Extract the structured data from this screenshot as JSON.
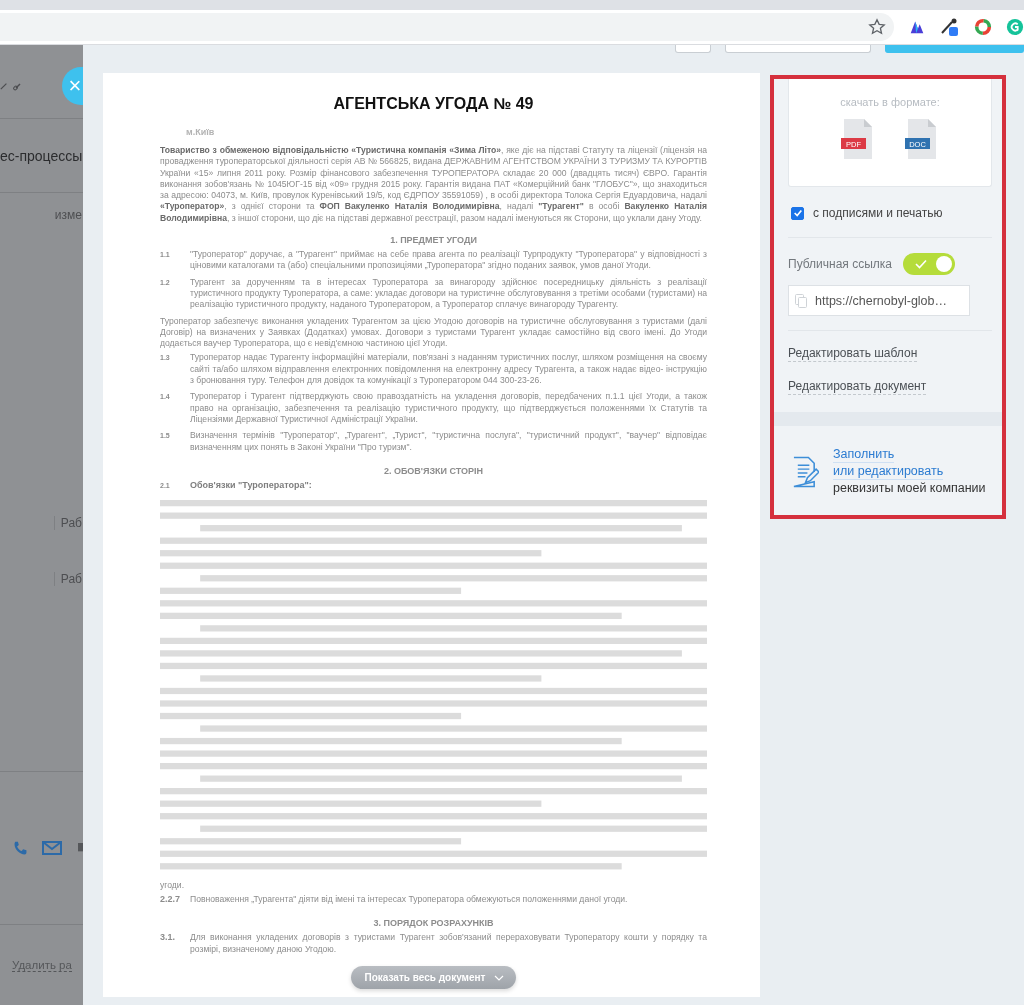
{
  "background_page": {
    "close_button": "×",
    "section_title": "ес-процессы",
    "column_header": "изме",
    "rows": [
      "Раб",
      "Раб"
    ],
    "delete_link": "Удалить ра"
  },
  "document": {
    "title": "АГЕНТСЬКА УГОДА № 49",
    "city": "м.Київ",
    "blocks_top": [
      {
        "kind": "paragraph",
        "text": "**Товариство з обмеженою відповідальністю «Туристична компанія «Зима Літо»**, яке діє на підставі Статуту та ліцензії (ліцензія на провадження туроператорської діяльності серія АВ № 566825, видана ДЕРЖАВНИМ АГЕНТСТВОМ УКРАЇНИ З ТУРИЗМУ ТА КУРОРТІВ України «15» липня 2011 року. Розмір фінансового забезпечення ТУРОПЕРАТОРА складає 20 000 (двадцять тисяч) ЄВРО. Гарантія виконання зобов'язань № 1045ЮГ-15 від «09» грудня 2015 року. Гарантія видана ПАТ «Комерційний банк \"ГЛОБУС\"», що знаходиться за адресою: 04073, м. Київ, провулок Куренівський 19/5, код ЄДРПОУ 35591059) , в особі директора Толока Сергія Едуардовича, надалі **«Туроператор»**, з однієї сторони та **ФОП Вакуленко Наталія Володимирівна**, надалі **\"Турагент\"** в особі **Вакуленко Наталія Володимирівна**, з іншої сторони, що діє на підставі державної реєстрації, разом надалі іменуються як Сторони, що уклали дану Угоду."
      },
      {
        "kind": "heading",
        "text": "1. ПРЕДМЕТ УГОДИ"
      },
      {
        "kind": "clause",
        "number": "1.1",
        "text": "\"Туроператор\" доручає, а \"Турагент\" приймає на себе права агента по реалізації Турпродукту \"Туроператора\" у відповідності з ціновими каталогами та (або) спеціальними пропозиціями „Туроператора\" згідно поданих заявок, умов даної Угоди."
      },
      {
        "kind": "clause",
        "number": "1.2",
        "text": "Турагент за дорученням та в інтересах Туроператора за винагороду здійснює посередницьку діяльність з реалізації туристичного продукту Туроператора, а саме: укладає договори на туристичне обслуговування з третіми особами (туристами) на реалізацію туристичного продукту, наданого Туроператором, а Туроператор сплачує винагороду Турагенту."
      },
      {
        "kind": "paragraph",
        "text": "Туроператор забезпечує виконання укладених Турагентом за цією Угодою договорів на туристичне обслуговування з туристами (далі Договір) на визначених у Заявках (Додатках) умовах. Договори з туристами Турагент укладає самостійно від свого імені. До Угоди додається ваучер Туроператора, що є невід'ємною частиною цієї Угоди."
      },
      {
        "kind": "clause",
        "number": "1.3",
        "text": "Туроператор надає Турагенту інформаційні матеріали, пов'язані з наданням туристичних послуг, шляхом розміщення на своєму сайті та/або шляхом відправлення електронних повідомлення на електронну адресу Турагента, а також надає відео- інструкцію з бронювання туру. Телефон для довідок та комунікації з Туроператором 044 300-23-26."
      },
      {
        "kind": "clause",
        "number": "1.4",
        "text": "Туроператор і Турагент підтверджують свою правоздатність на укладення договорів, передбачених п.1.1 цієї Угоди, а також право на організацію, забезпечення та реалізацію туристичного продукту, що підтверджується положеннями їх Статутів та Ліцензіями Державної Туристичної Адміністрації України."
      },
      {
        "kind": "clause",
        "number": "1.5",
        "text": "Визначення термінів \"Туроператор\", „Турагент\", „Турист\", \"туристична послуга\", \"туристичний продукт\", \"ваучер\" відповідає визначенням цих понять в Законі України \"Про туризм\"."
      },
      {
        "kind": "heading",
        "text": "2. ОБОВ'ЯЗКИ СТОРІН"
      },
      {
        "kind": "subheading",
        "number": "2.1",
        "text": "Обов'язки \"Туроператора\":"
      }
    ],
    "blocks_bottom": [
      {
        "kind": "paragraph",
        "text": "угоди."
      },
      {
        "kind": "clause",
        "number": "2.2.7",
        "text": "Повноваження „Турагента\" діяти від імені та інтересах Туроператора обмежуються положеннями даної угоди."
      },
      {
        "kind": "heading",
        "text": "3. ПОРЯДОК РОЗРАХУНКІВ"
      },
      {
        "kind": "clause",
        "number": "3.1.",
        "text": "Для виконання укладених договорів з туристами Турагент зобов'язаний перераховувати Туроператору кошти у порядку та розмірі, визначеному даною Угодою."
      }
    ],
    "show_all_button": "Показать весь документ"
  },
  "panel": {
    "download_label": "скачать в формате:",
    "formats": [
      {
        "label": "PDF",
        "color": "#dc3a45"
      },
      {
        "label": "DOC",
        "color": "#2f72b0"
      }
    ],
    "signatures": {
      "label": "с подписями и печатью",
      "checked": true
    },
    "public_link": {
      "label": "Публичная ссылка",
      "on": true,
      "url": "https://chernobyl-glob…"
    },
    "edit_links": [
      "Редактировать шаблон",
      "Редактировать документ"
    ],
    "company": {
      "links": [
        "Заполнить",
        "или редактировать"
      ],
      "text": "реквизиты моей компании"
    }
  }
}
